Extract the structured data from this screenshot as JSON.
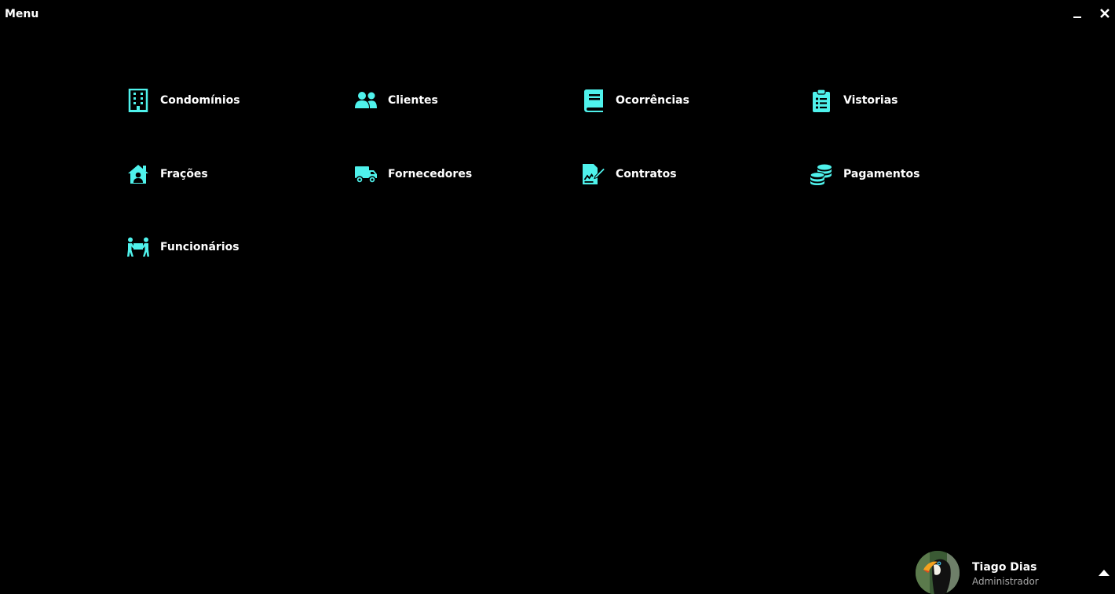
{
  "window": {
    "title": "Menu"
  },
  "theme": {
    "accent": "#4ff2ec",
    "background": "#000000",
    "text": "#ffffff",
    "subtext": "#a8a8a8"
  },
  "menu": {
    "items": [
      {
        "label": "Condomínios",
        "icon": "building-icon"
      },
      {
        "label": "Clientes",
        "icon": "users-icon"
      },
      {
        "label": "Ocorrências",
        "icon": "book-icon"
      },
      {
        "label": "Vistorias",
        "icon": "clipboard-list-icon"
      },
      {
        "label": "Frações",
        "icon": "house-user-icon"
      },
      {
        "label": "Fornecedores",
        "icon": "truck-icon"
      },
      {
        "label": "Contratos",
        "icon": "file-signature-icon"
      },
      {
        "label": "Pagamentos",
        "icon": "coins-icon"
      },
      {
        "label": "Funcionários",
        "icon": "people-carry-icon"
      }
    ]
  },
  "user": {
    "name": "Tiago Dias",
    "role": "Administrador",
    "avatar": "toucan-photo"
  }
}
